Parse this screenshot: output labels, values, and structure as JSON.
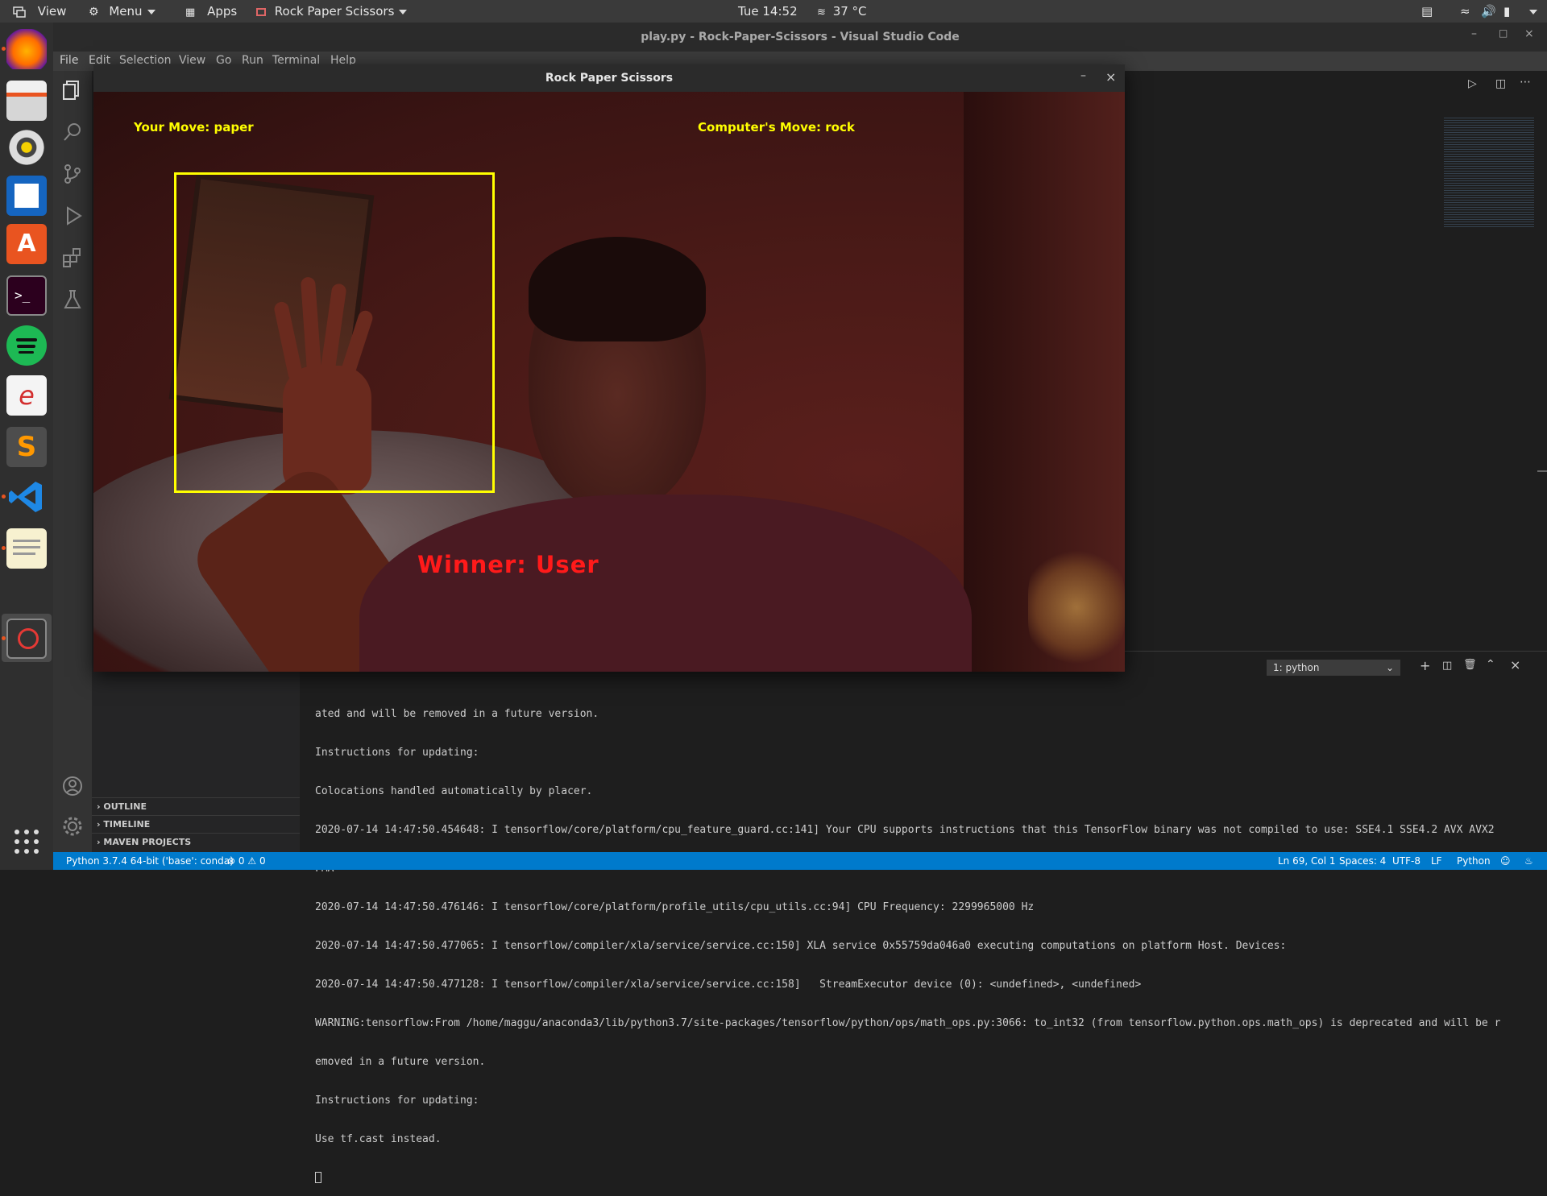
{
  "top_panel": {
    "view": "View",
    "menu": "Menu",
    "apps": "Apps",
    "active_app": "Rock Paper Scissors",
    "clock": "Tue 14:52",
    "weather": "37 °C"
  },
  "vscode": {
    "title": "play.py - Rock-Paper-Scissors - Visual Studio Code",
    "menu": [
      "File",
      "Edit",
      "Selection",
      "View",
      "Go",
      "Run",
      "Terminal",
      "Help"
    ],
    "sidebar_sections": [
      "OUTLINE",
      "TIMELINE",
      "MAVEN PROJECTS"
    ],
    "terminal_select": "1: python",
    "terminal_lines": [
      "ated and will be removed in a future version.",
      "Instructions for updating:",
      "Colocations handled automatically by placer.",
      "2020-07-14 14:47:50.454648: I tensorflow/core/platform/cpu_feature_guard.cc:141] Your CPU supports instructions that this TensorFlow binary was not compiled to use: SSE4.1 SSE4.2 AVX AVX2",
      "FMA",
      "2020-07-14 14:47:50.476146: I tensorflow/core/platform/profile_utils/cpu_utils.cc:94] CPU Frequency: 2299965000 Hz",
      "2020-07-14 14:47:50.477065: I tensorflow/compiler/xla/service/service.cc:150] XLA service 0x55759da046a0 executing computations on platform Host. Devices:",
      "2020-07-14 14:47:50.477128: I tensorflow/compiler/xla/service/service.cc:158]   StreamExecutor device (0): <undefined>, <undefined>",
      "WARNING:tensorflow:From /home/maggu/anaconda3/lib/python3.7/site-packages/tensorflow/python/ops/math_ops.py:3066: to_int32 (from tensorflow.python.ops.math_ops) is deprecated and will be r",
      "emoved in a future version.",
      "Instructions for updating:",
      "Use tf.cast instead."
    ],
    "status": {
      "interpreter": "Python 3.7.4 64-bit ('base': conda)",
      "problems": "0",
      "warnings": "0",
      "position": "Ln 69, Col 1",
      "spaces": "Spaces: 4",
      "encoding": "UTF-8",
      "eol": "LF",
      "language": "Python"
    }
  },
  "game_window": {
    "title": "Rock Paper Scissors",
    "your_move": "Your Move: paper",
    "computer_move": "Computer's Move: rock",
    "winner": "Winner: User"
  }
}
